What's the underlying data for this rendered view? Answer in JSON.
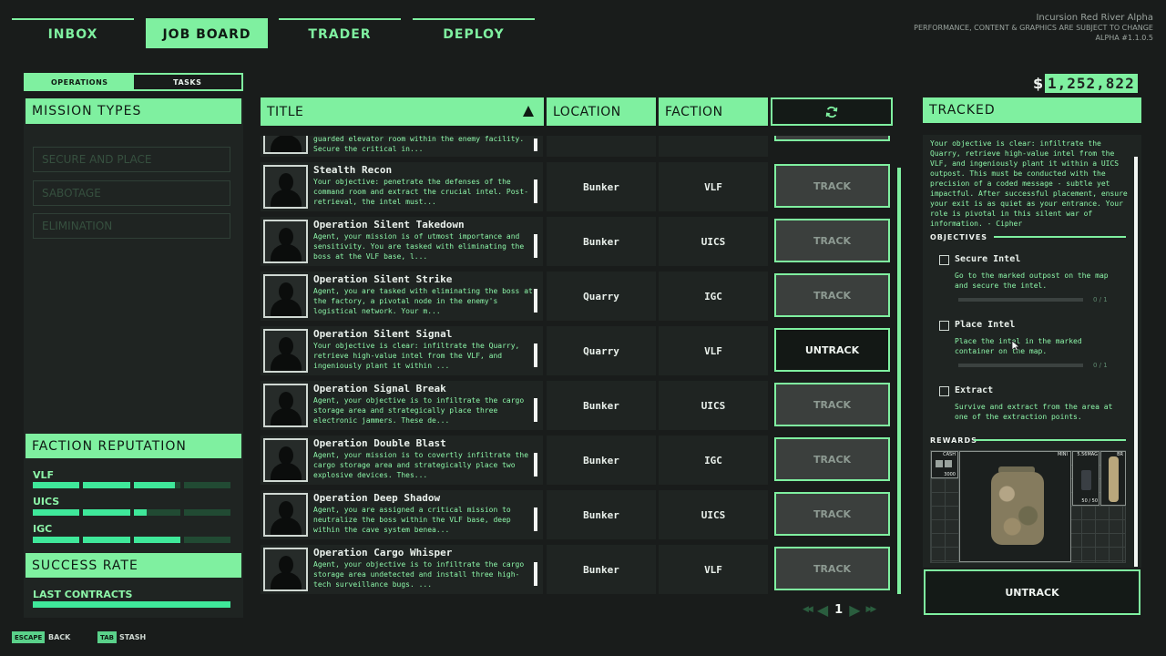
{
  "nav": {
    "tabs": [
      {
        "label": "INBOX",
        "active": false
      },
      {
        "label": "JOB BOARD",
        "active": true
      },
      {
        "label": "TRADER",
        "active": false
      },
      {
        "label": "DEPLOY",
        "active": false
      }
    ]
  },
  "build": {
    "title": "Incursion Red River Alpha",
    "notice": "PERFORMANCE, CONTENT & GRAPHICS ARE SUBJECT TO CHANGE",
    "version": "ALPHA #1.1.0.5"
  },
  "money": {
    "symbol": "$",
    "amount": "1,252,822"
  },
  "left": {
    "subtabs": [
      {
        "label": "OPERATIONS",
        "active": true
      },
      {
        "label": "TASKS",
        "active": false
      }
    ],
    "mission_types_title": "MISSION TYPES",
    "mission_types": [
      "SECURE AND PLACE",
      "SABOTAGE",
      "ELIMINATION"
    ],
    "faction_title": "FACTION REPUTATION",
    "factions": [
      {
        "name": "VLF",
        "level": 0.72
      },
      {
        "name": "UICS",
        "level": 0.57
      },
      {
        "name": "IGC",
        "level": 0.75
      }
    ],
    "success_title": "SUCCESS RATE",
    "last_contracts_label": "LAST CONTRACTS",
    "last_contracts_level": 1.0
  },
  "table": {
    "headers": {
      "title": "TITLE",
      "location": "LOCATION",
      "faction": "FACTION"
    },
    "partial_row": {
      "desc": "guarded elevator room within the enemy facility. Secure the critical in..."
    },
    "rows": [
      {
        "name": "Stealth Recon",
        "desc": "Your objective: penetrate the defenses of the command room and extract the crucial intel. Post-retrieval, the intel must...",
        "location": "Bunker",
        "faction": "VLF",
        "action": "TRACK",
        "tracked": false
      },
      {
        "name": "Operation Silent Takedown",
        "desc": "Agent, your mission is of utmost importance and sensitivity. You are tasked with eliminating the boss at the VLF base, l...",
        "location": "Bunker",
        "faction": "UICS",
        "action": "TRACK",
        "tracked": false
      },
      {
        "name": "Operation Silent Strike",
        "desc": "Agent, you are tasked with eliminating the boss at the factory, a pivotal node in the enemy's logistical network. Your m...",
        "location": "Quarry",
        "faction": "IGC",
        "action": "TRACK",
        "tracked": false
      },
      {
        "name": "Operation Silent Signal",
        "desc": "Your objective is clear: infiltrate the Quarry, retrieve high-value intel from the VLF, and ingeniously plant it within ...",
        "location": "Quarry",
        "faction": "VLF",
        "action": "UNTRACK",
        "tracked": true
      },
      {
        "name": "Operation Signal Break",
        "desc": "Agent, your objective is to infiltrate the cargo storage area and strategically place three electronic jammers. These de...",
        "location": "Bunker",
        "faction": "UICS",
        "action": "TRACK",
        "tracked": false
      },
      {
        "name": "Operation Double Blast",
        "desc": "Agent, your mission is to covertly infiltrate the cargo storage area and strategically place two explosive devices. Thes...",
        "location": "Bunker",
        "faction": "IGC",
        "action": "TRACK",
        "tracked": false
      },
      {
        "name": "Operation Deep Shadow",
        "desc": "Agent, you are assigned a critical mission to neutralize the boss within the VLF base, deep within the cave system benea...",
        "location": "Bunker",
        "faction": "UICS",
        "action": "TRACK",
        "tracked": false
      },
      {
        "name": "Operation Cargo Whisper",
        "desc": "Agent, your objective is to infiltrate the cargo storage area undetected and install three high-tech surveillance bugs. ...",
        "location": "Bunker",
        "faction": "VLF",
        "action": "TRACK",
        "tracked": false
      }
    ],
    "page": "1"
  },
  "tracked": {
    "title": "TRACKED",
    "desc": "Your objective is clear: infiltrate the Quarry, retrieve high-value intel from the VLF, and ingeniously plant it within a UICS outpost. This must be conducted with the precision of a coded message - subtle yet impactful. After successful placement, ensure your exit is as quiet as your entrance. Your role is pivotal in this silent war of information. - Cipher",
    "objectives_label": "OBJECTIVES",
    "objectives": [
      {
        "title": "Secure Intel",
        "desc": "Go to the marked outpost on the map and secure the intel.",
        "progress": "0 / 1",
        "has_bar": true
      },
      {
        "title": "Place Intel",
        "desc": "Place the intel in the marked container on the map.",
        "progress": "0 / 1",
        "has_bar": true
      },
      {
        "title": "Extract",
        "desc": "Survive and extract from the area at one of the extraction points.",
        "progress": "",
        "has_bar": false
      }
    ],
    "rewards_label": "REWARDS",
    "rewards": {
      "cash_label": "CASH",
      "cash_value": "3000",
      "mini_label": "MINI",
      "ammo_label": "5.56MAG",
      "ammo_count": "50 / 50",
      "br_label": "BR"
    },
    "untrack_label": "UNTRACK"
  },
  "hints": [
    {
      "key": "ESCAPE",
      "label": "BACK"
    },
    {
      "key": "TAB",
      "label": "STASH"
    }
  ]
}
